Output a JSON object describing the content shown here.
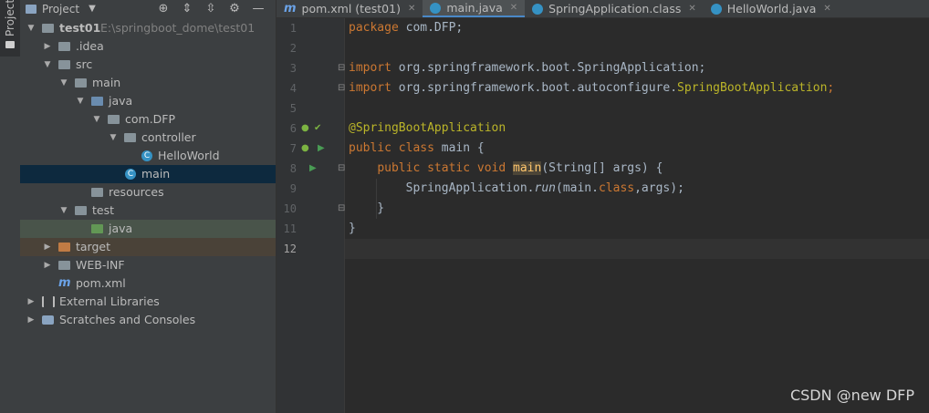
{
  "sidebar": {
    "tab_label": "Project"
  },
  "project_panel": {
    "title": "Project",
    "tree": [
      {
        "label": "test01",
        "path": "E:\\springboot_dome\\test01"
      },
      {
        "label": ".idea"
      },
      {
        "label": "src"
      },
      {
        "label": "main"
      },
      {
        "label": "java"
      },
      {
        "label": "com.DFP"
      },
      {
        "label": "controller"
      },
      {
        "label": "HelloWorld"
      },
      {
        "label": "main"
      },
      {
        "label": "resources"
      },
      {
        "label": "test"
      },
      {
        "label": "java"
      },
      {
        "label": "target"
      },
      {
        "label": "WEB-INF"
      },
      {
        "label": "pom.xml"
      },
      {
        "label": "External Libraries"
      },
      {
        "label": "Scratches and Consoles"
      }
    ]
  },
  "tabs": [
    {
      "label": "pom.xml (test01)"
    },
    {
      "label": "main.java"
    },
    {
      "label": "SpringApplication.class"
    },
    {
      "label": "HelloWorld.java"
    }
  ],
  "editor": {
    "line_numbers": [
      "1",
      "2",
      "3",
      "4",
      "5",
      "6",
      "7",
      "8",
      "9",
      "10",
      "11",
      "12"
    ],
    "code": {
      "l1_kw": "package",
      "l1_rest": " com.DFP;",
      "l3_kw": "import",
      "l3_rest": " org.springframework.boot.SpringApplication;",
      "l4_kw": "import",
      "l4_pkg": " org.springframework.boot.autoconfigure.",
      "l4_cls": "SpringBootApplication",
      "l4_semi": ";",
      "l6_ann": "@SpringBootApplication",
      "l7_kw": "public class",
      "l7_rest": " main {",
      "l8_indent": "    ",
      "l8_kw": "public static void",
      "l8_sp": " ",
      "l8_name": "main",
      "l8_rest": "(String[] args) {",
      "l9_indent": "        ",
      "l9_cls": "SpringApplication.",
      "l9_run": "run",
      "l9_a": "(main.",
      "l9_kw": "class",
      "l9_b": ",args);",
      "l10": "    }",
      "l11": "}"
    }
  },
  "watermark": "CSDN @new DFP"
}
